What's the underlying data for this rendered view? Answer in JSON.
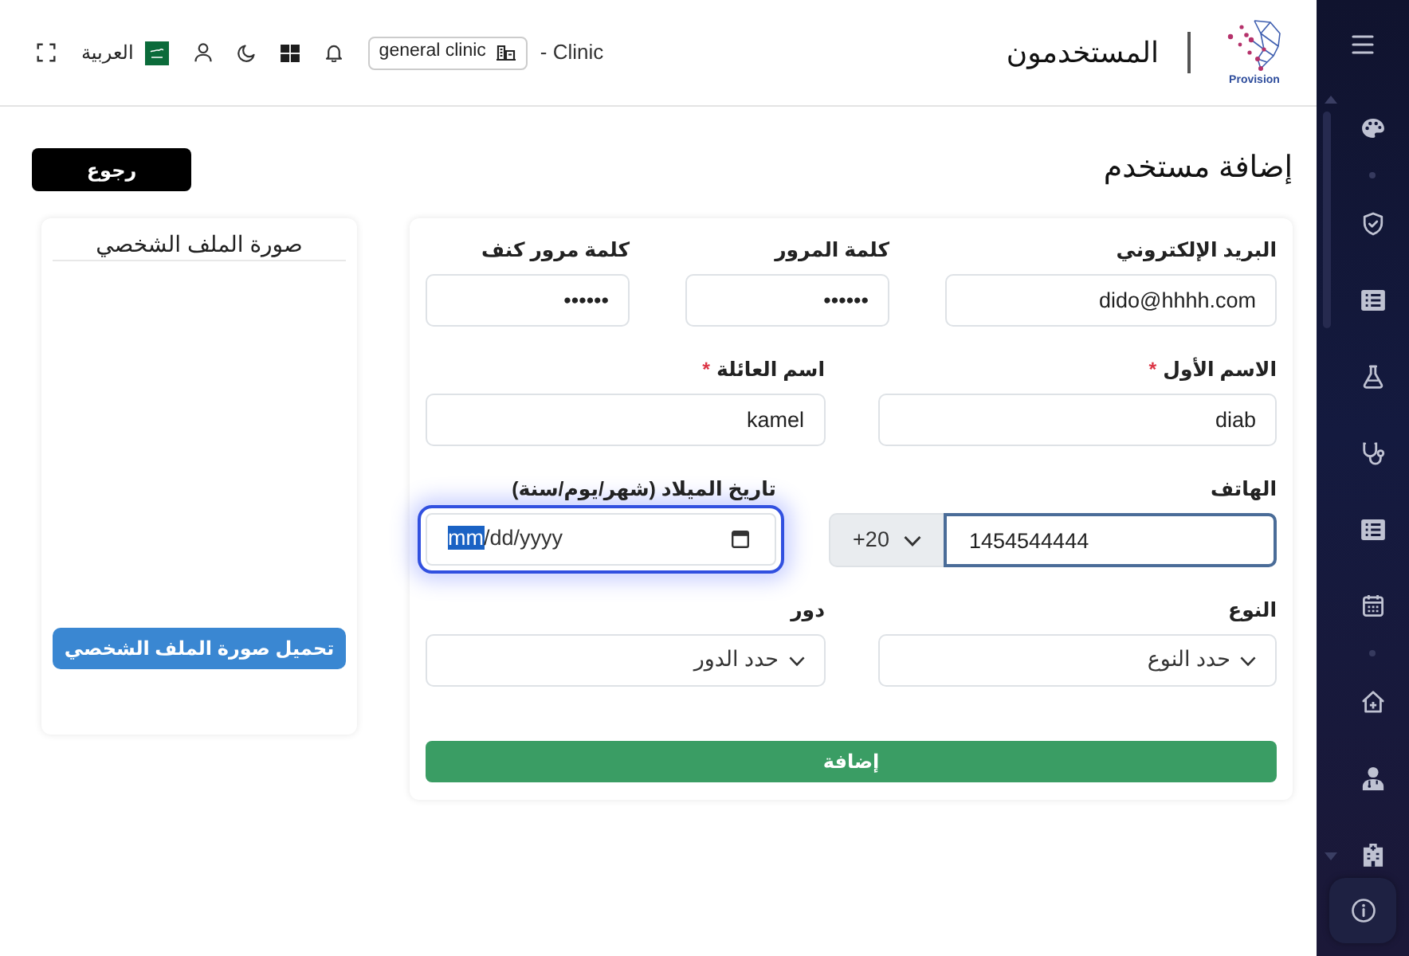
{
  "header": {
    "logo_text": "Provision",
    "title": "المستخدمون",
    "clinic_label": "- Clinic",
    "clinic_button": "general clinic",
    "language": "العربية"
  },
  "page": {
    "heading": "إضافة مستخدم",
    "back_button": "رجوع"
  },
  "form": {
    "rows": [
      [
        {
          "kind": "text",
          "label": "البريد الإلكتروني",
          "value": "dido@hhhh.com",
          "focused": false
        },
        {
          "kind": "password",
          "label": "كلمة المرور",
          "value": "••••••",
          "focused": false
        },
        {
          "kind": "password",
          "label": "كلمة مرور كنف",
          "value": "••••••",
          "focused": false
        }
      ],
      [
        {
          "kind": "text",
          "label": "الاسم الأول",
          "required_mark": "*",
          "value": "diab",
          "focused": false
        },
        {
          "kind": "text",
          "label": "اسم العائلة",
          "required_mark": "*",
          "value": "kamel",
          "focused": false
        }
      ],
      [
        {
          "kind": "phone",
          "label": "الهاتف",
          "country_code": "+20",
          "value": "1454544444",
          "focused": false
        },
        {
          "kind": "date",
          "label": "تاريخ الميلاد (شهر/يوم/سنة)",
          "focused": true,
          "parts": [
            {
              "text": "mm",
              "selected": true
            },
            {
              "text": "/dd/yyyy",
              "selected": false
            }
          ]
        }
      ],
      [
        {
          "kind": "select",
          "label": "النوع",
          "value": "حدد النوع",
          "focused": false
        },
        {
          "kind": "select",
          "label": "دور",
          "value": "حدد الدور",
          "focused": false
        }
      ]
    ],
    "submit_button": "إضافة"
  },
  "profile_photo": {
    "title": "صورة الملف الشخصي",
    "upload_button": "تحميل صورة الملف الشخصي"
  }
}
